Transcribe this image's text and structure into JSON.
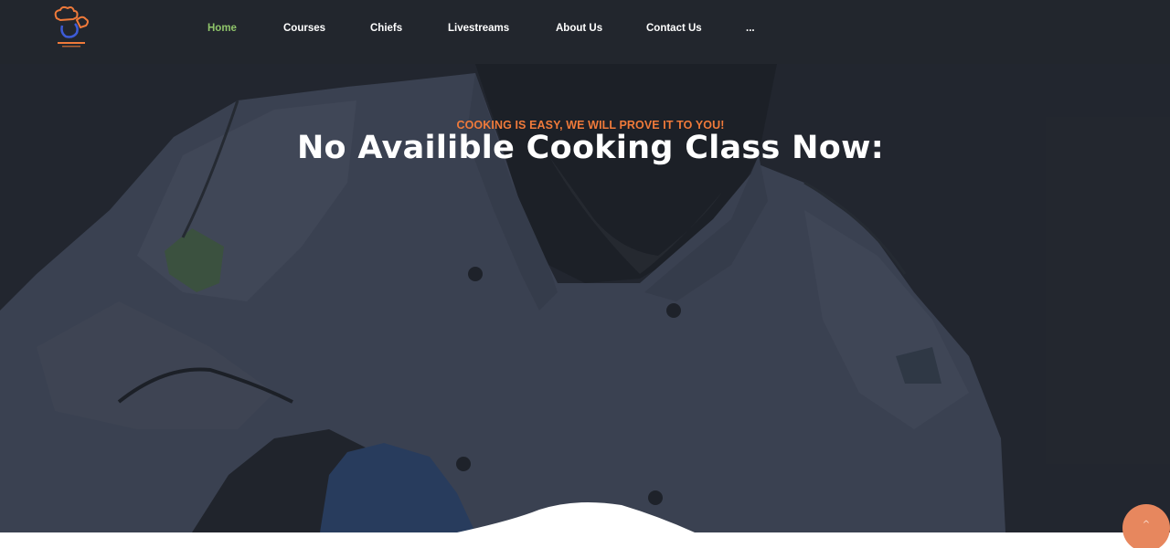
{
  "logo": {
    "icon": "chef-hat-logo-icon",
    "primary_color": "#f07a3a",
    "outline_color": "#3d5bd6"
  },
  "nav": {
    "items": [
      {
        "label": "Home",
        "active": true
      },
      {
        "label": "Courses",
        "active": false
      },
      {
        "label": "Chiefs",
        "active": false
      },
      {
        "label": "Livestreams",
        "active": false
      },
      {
        "label": "About Us",
        "active": false
      },
      {
        "label": "Contact Us",
        "active": false
      },
      {
        "label": "...",
        "active": false
      }
    ]
  },
  "hero": {
    "tagline": "COOKING IS EASY, WE WILL PROVE IT TO YOU!",
    "headline": "No Availible Cooking Class Now:"
  },
  "scroll_top": {
    "icon": "chevron-up-icon",
    "glyph": "^"
  },
  "colors": {
    "accent_orange": "#f07a3a",
    "active_nav_green": "#8fc46a",
    "background_dark": "#22262d",
    "scroll_button": "#e7875e"
  }
}
